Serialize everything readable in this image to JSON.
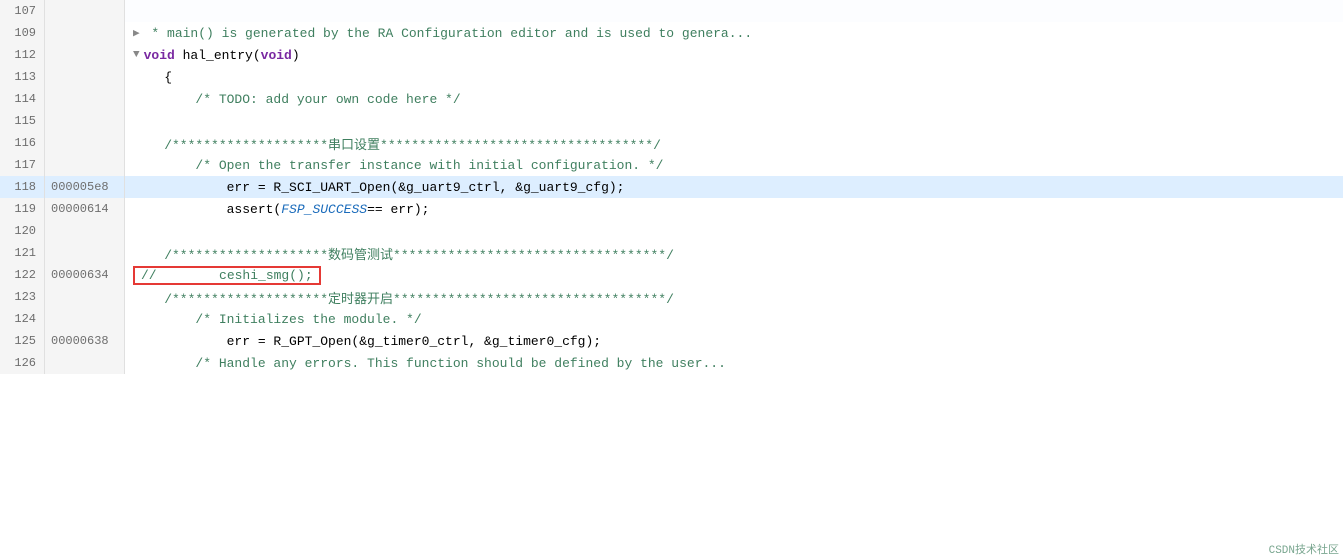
{
  "editor": {
    "lines": [
      {
        "num": "107",
        "addr": "",
        "indent": 0,
        "content": "",
        "type": "empty"
      },
      {
        "num": "109",
        "addr": "",
        "indent": 0,
        "content": "collapsed_comment",
        "type": "collapsed"
      },
      {
        "num": "112",
        "addr": "",
        "indent": 0,
        "content": "void_hal_entry",
        "type": "function_def"
      },
      {
        "num": "113",
        "addr": "",
        "indent": 1,
        "content": "{",
        "type": "brace"
      },
      {
        "num": "114",
        "addr": "",
        "indent": 2,
        "content": "todo_comment",
        "type": "todo"
      },
      {
        "num": "115",
        "addr": "",
        "indent": 0,
        "content": "",
        "type": "empty"
      },
      {
        "num": "116",
        "addr": "",
        "indent": 1,
        "content": "serial_comment",
        "type": "cn_comment"
      },
      {
        "num": "117",
        "addr": "",
        "indent": 2,
        "content": "open_comment",
        "type": "block_comment"
      },
      {
        "num": "118",
        "addr": "000005e8",
        "indent": 3,
        "content": "uart_open",
        "type": "code",
        "highlighted": true
      },
      {
        "num": "119",
        "addr": "00000614",
        "indent": 3,
        "content": "assert_fsp",
        "type": "code",
        "highlighted": false
      },
      {
        "num": "120",
        "addr": "",
        "indent": 0,
        "content": "",
        "type": "empty"
      },
      {
        "num": "121",
        "addr": "",
        "indent": 1,
        "content": "digit_comment",
        "type": "cn_comment"
      },
      {
        "num": "122",
        "addr": "00000634",
        "indent": 2,
        "content": "ceshi_smg",
        "type": "code_commented",
        "boxed": true
      },
      {
        "num": "123",
        "addr": "",
        "indent": 1,
        "content": "timer_comment",
        "type": "cn_comment"
      },
      {
        "num": "124",
        "addr": "",
        "indent": 2,
        "content": "init_comment",
        "type": "block_comment"
      },
      {
        "num": "125",
        "addr": "00000638",
        "indent": 3,
        "content": "gpt_open",
        "type": "code"
      },
      {
        "num": "126",
        "addr": "",
        "indent": 3,
        "content": "handle_comment",
        "type": "block_comment_partial"
      }
    ]
  }
}
